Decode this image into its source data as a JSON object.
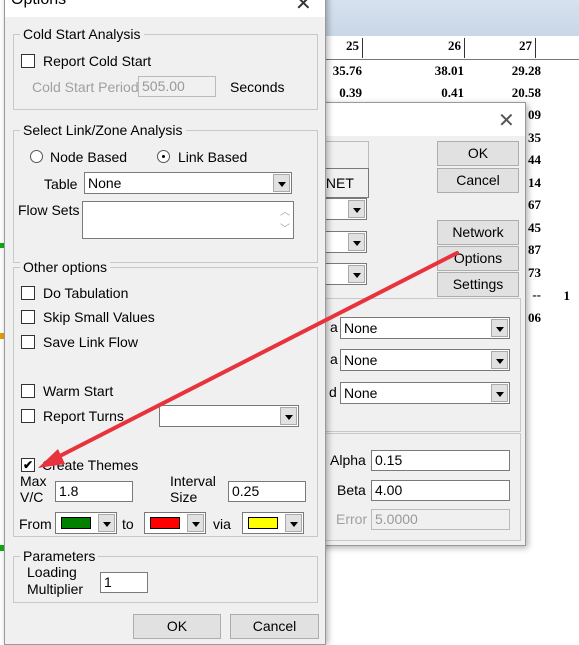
{
  "table": {
    "headers": [
      "25",
      "26",
      "27"
    ],
    "rows": [
      [
        "35.76",
        "38.01",
        "29.28"
      ],
      [
        "0.39",
        "0.41",
        "20.58"
      ]
    ],
    "col27_partial": [
      "09",
      "35",
      "44",
      "14",
      "67",
      "45",
      "87",
      "73",
      "--",
      "06"
    ],
    "extra": "1"
  },
  "bg_dialog": {
    "field_text": "T.NET",
    "ok": "OK",
    "cancel": "Cancel",
    "network": "Network",
    "options": "Options",
    "settings": "Settings",
    "combos": [
      {
        "label": "a",
        "value": "None"
      },
      {
        "label": "a",
        "value": "None"
      },
      {
        "label": "d",
        "value": "None"
      }
    ],
    "alpha_label": "Alpha",
    "alpha": "0.15",
    "beta_label": "Beta",
    "beta": "4.00",
    "error_label": "Error",
    "error": "5.0000"
  },
  "options": {
    "title": "Options",
    "cold": {
      "legend": "Cold Start Analysis",
      "report": "Report Cold Start",
      "period_label": "Cold Start Period",
      "period": "505.00",
      "unit": "Seconds"
    },
    "link": {
      "legend": "Select Link/Zone Analysis",
      "node": "Node Based",
      "link": "Link Based",
      "selected": "link",
      "table_label": "Table",
      "table": "None",
      "flow_label": "Flow Sets"
    },
    "other": {
      "legend": "Other options",
      "tabulation": "Do Tabulation",
      "skip": "Skip Small Values",
      "save": "Save Link Flow",
      "warm": "Warm Start",
      "turns": "Report Turns",
      "themes": "Create Themes",
      "themes_checked": true,
      "maxvc_label1": "Max",
      "maxvc_label2": "V/C",
      "maxvc": "1.8",
      "interval_label1": "Interval",
      "interval_label2": "Size",
      "interval": "0.25",
      "from": "From",
      "to": "to",
      "via": "via",
      "colors": {
        "from": "#008000",
        "to": "#ff0000",
        "via": "#ffff00"
      }
    },
    "params": {
      "legend": "Parameters",
      "loading1": "Loading",
      "loading2": "Multiplier",
      "loading": "1"
    },
    "ok": "OK",
    "cancel": "Cancel"
  },
  "annotation": {
    "arrow_color": "#e8323c"
  }
}
